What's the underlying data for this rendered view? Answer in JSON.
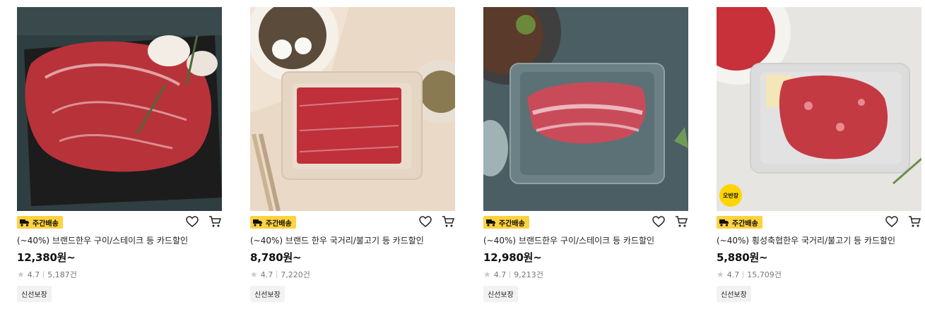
{
  "products": [
    {
      "delivery_label": "주간배송",
      "title": "(~40%) 브랜드한우 구이/스테이크 등 카드할인",
      "price": "12,380원~",
      "rating": "4.7",
      "review_count": "5,187건",
      "badge": "신선보장"
    },
    {
      "delivery_label": "주간배송",
      "title": "(~40%) 브랜드 한우 국거리/불고기 등 카드할인",
      "price": "8,780원~",
      "rating": "4.7",
      "review_count": "7,220건",
      "badge": "신선보장"
    },
    {
      "delivery_label": "주간배송",
      "title": "(~40%) 브랜드한우 구이/스테이크 등 카드할인",
      "price": "12,980원~",
      "rating": "4.7",
      "review_count": "9,213건",
      "badge": "신선보장"
    },
    {
      "delivery_label": "주간배송",
      "title": "(~40%) 횡성축협한우 국거리/불고기 등 카드할인",
      "price": "5,880원~",
      "rating": "4.7",
      "review_count": "15,709건",
      "badge": "신선보장",
      "image_tag": "오반장"
    }
  ],
  "colors": {
    "delivery_badge": "#ffd23f",
    "tag_circle": "#ffd400"
  },
  "icons": {
    "wishlist": "heart-icon",
    "cart": "cart-icon",
    "delivery": "truck-icon",
    "rating": "star-icon"
  }
}
